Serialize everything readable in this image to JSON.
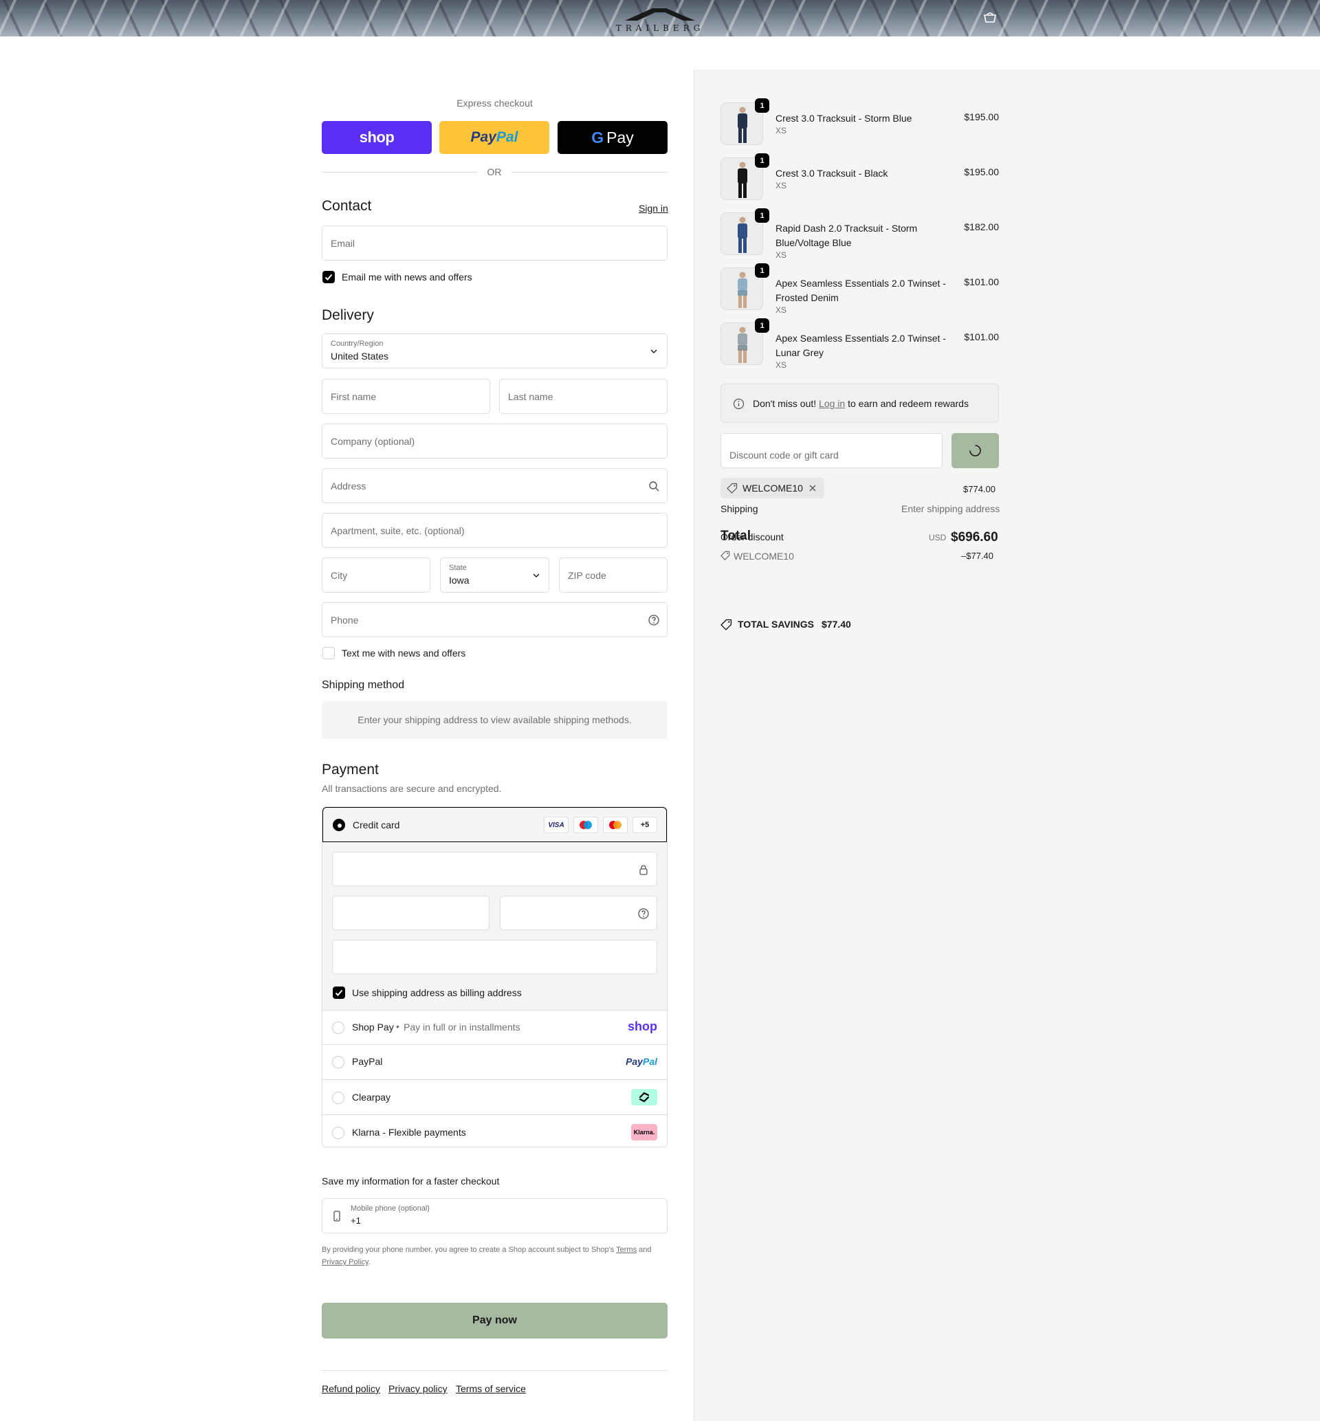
{
  "header": {
    "brand": "TRAILBERG",
    "cart_icon": "cart-icon"
  },
  "express": {
    "title": "Express checkout",
    "shop_label": "shop",
    "paypal_label_a": "Pay",
    "paypal_label_b": "Pal",
    "gpay_label": "Pay",
    "or_label": "OR"
  },
  "contact": {
    "title": "Contact",
    "sign_in": "Sign in",
    "email_placeholder": "Email",
    "news_checkbox_label": "Email me with news and offers",
    "news_checked": true
  },
  "delivery": {
    "title": "Delivery",
    "country_label": "Country/Region",
    "country_value": "United States",
    "first_name_placeholder": "First name",
    "last_name_placeholder": "Last name",
    "company_placeholder": "Company (optional)",
    "address_placeholder": "Address",
    "apartment_placeholder": "Apartment, suite, etc. (optional)",
    "city_placeholder": "City",
    "state_label": "State",
    "state_value": "Iowa",
    "zip_placeholder": "ZIP code",
    "phone_placeholder": "Phone",
    "text_checkbox_label": "Text me with news and offers",
    "text_checked": false
  },
  "shipping_method": {
    "title": "Shipping method",
    "notice": "Enter your shipping address to view available shipping methods."
  },
  "payment": {
    "title": "Payment",
    "subtitle": "All transactions are secure and encrypted.",
    "credit_card_label": "Credit card",
    "card_badges": [
      "VISA",
      "+5"
    ],
    "billing_checkbox_label": "Use shipping address as billing address",
    "billing_checked": true,
    "shop_pay_label": "Shop Pay",
    "shop_pay_sub": "Pay in full or in installments",
    "shop_pay_logo": "shop",
    "paypal_label": "PayPal",
    "paypal_logo_a": "Pay",
    "paypal_logo_b": "Pal",
    "clearpay_label": "Clearpay",
    "klarna_label": "Klarna - Flexible payments",
    "klarna_logo": "Klarna."
  },
  "save_info": {
    "title": "Save my information for a faster checkout",
    "mobile_label": "Mobile phone (optional)",
    "mobile_value": "+1",
    "disclaimer_a": "By providing your phone number, you agree to create a Shop account subject to Shop's",
    "terms": "Terms",
    "disclaimer_and": "and",
    "privacy": "Privacy Policy",
    "period": "."
  },
  "pay_button": "Pay now",
  "footer_links": [
    "Refund policy",
    "Privacy policy",
    "Terms of service"
  ],
  "summary": {
    "items": [
      {
        "name": "Crest 3.0 Tracksuit - Storm Blue",
        "size": "XS",
        "price": "$195.00",
        "qty": "1"
      },
      {
        "name": "Crest 3.0 Tracksuit - Black",
        "size": "XS",
        "price": "$195.00",
        "qty": "1"
      },
      {
        "name": "Rapid Dash 2.0 Tracksuit - Storm Blue/Voltage Blue",
        "size": "XS",
        "price": "$182.00",
        "qty": "1"
      },
      {
        "name": "Apex Seamless Essentials 2.0 Twinset - Frosted Denim",
        "size": "XS",
        "price": "$101.00",
        "qty": "1"
      },
      {
        "name": "Apex Seamless Essentials 2.0 Twinset - Lunar Grey",
        "size": "XS",
        "price": "$101.00",
        "qty": "1"
      }
    ],
    "rewards_a": "Don't miss out!",
    "rewards_link": "Log in",
    "rewards_b": "to earn and redeem rewards",
    "discount_placeholder": "Discount code or gift card",
    "applied_code": "WELCOME10",
    "subtotal_value": "$774.00",
    "shipping_label": "Shipping",
    "shipping_value": "Enter shipping address",
    "total_label": "Total",
    "order_discount_label": "Order discount",
    "currency": "USD",
    "total_value": "$696.60",
    "discount_code": "WELCOME10",
    "discount_value": "–$77.40",
    "savings_label": "TOTAL SAVINGS",
    "savings_value": "$77.40"
  },
  "colors": {
    "shop_purple": "#5a31f4",
    "paypal_yellow": "#ffc439",
    "gpay_black": "#000000",
    "pay_button": "#a5b8a0",
    "summary_bg": "#f5f5f5"
  }
}
